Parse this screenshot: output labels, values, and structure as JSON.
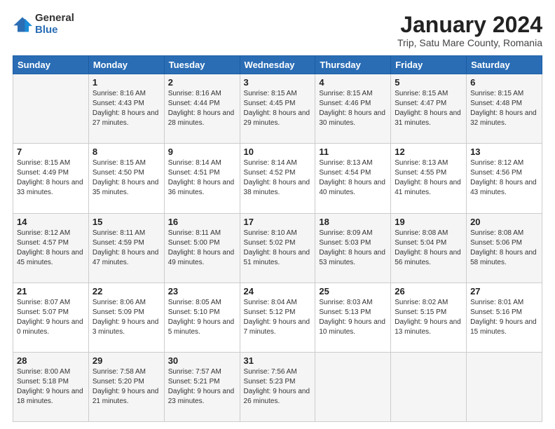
{
  "header": {
    "title": "January 2024",
    "subtitle": "Trip, Satu Mare County, Romania",
    "logo_general": "General",
    "logo_blue": "Blue"
  },
  "weekdays": [
    "Sunday",
    "Monday",
    "Tuesday",
    "Wednesday",
    "Thursday",
    "Friday",
    "Saturday"
  ],
  "weeks": [
    [
      {
        "day": "",
        "sunrise": "",
        "sunset": "",
        "daylight": "",
        "shade": true
      },
      {
        "day": "1",
        "sunrise": "8:16 AM",
        "sunset": "4:43 PM",
        "daylight": "8 hours and 27 minutes.",
        "shade": true
      },
      {
        "day": "2",
        "sunrise": "8:16 AM",
        "sunset": "4:44 PM",
        "daylight": "8 hours and 28 minutes.",
        "shade": true
      },
      {
        "day": "3",
        "sunrise": "8:15 AM",
        "sunset": "4:45 PM",
        "daylight": "8 hours and 29 minutes.",
        "shade": true
      },
      {
        "day": "4",
        "sunrise": "8:15 AM",
        "sunset": "4:46 PM",
        "daylight": "8 hours and 30 minutes.",
        "shade": true
      },
      {
        "day": "5",
        "sunrise": "8:15 AM",
        "sunset": "4:47 PM",
        "daylight": "8 hours and 31 minutes.",
        "shade": true
      },
      {
        "day": "6",
        "sunrise": "8:15 AM",
        "sunset": "4:48 PM",
        "daylight": "8 hours and 32 minutes.",
        "shade": true
      }
    ],
    [
      {
        "day": "7",
        "sunrise": "",
        "sunset": "",
        "daylight": "",
        "shade": false
      },
      {
        "day": "8",
        "sunrise": "8:15 AM",
        "sunset": "4:50 PM",
        "daylight": "8 hours and 35 minutes.",
        "shade": false
      },
      {
        "day": "9",
        "sunrise": "8:14 AM",
        "sunset": "4:51 PM",
        "daylight": "8 hours and 36 minutes.",
        "shade": false
      },
      {
        "day": "10",
        "sunrise": "8:14 AM",
        "sunset": "4:52 PM",
        "daylight": "8 hours and 38 minutes.",
        "shade": false
      },
      {
        "day": "11",
        "sunrise": "8:13 AM",
        "sunset": "4:54 PM",
        "daylight": "8 hours and 40 minutes.",
        "shade": false
      },
      {
        "day": "12",
        "sunrise": "8:13 AM",
        "sunset": "4:55 PM",
        "daylight": "8 hours and 41 minutes.",
        "shade": false
      },
      {
        "day": "13",
        "sunrise": "8:12 AM",
        "sunset": "4:56 PM",
        "daylight": "8 hours and 43 minutes.",
        "shade": false
      }
    ],
    [
      {
        "day": "14",
        "sunrise": "",
        "sunset": "",
        "daylight": "",
        "shade": true
      },
      {
        "day": "15",
        "sunrise": "8:11 AM",
        "sunset": "4:59 PM",
        "daylight": "8 hours and 47 minutes.",
        "shade": true
      },
      {
        "day": "16",
        "sunrise": "8:11 AM",
        "sunset": "5:00 PM",
        "daylight": "8 hours and 49 minutes.",
        "shade": true
      },
      {
        "day": "17",
        "sunrise": "8:10 AM",
        "sunset": "5:02 PM",
        "daylight": "8 hours and 51 minutes.",
        "shade": true
      },
      {
        "day": "18",
        "sunrise": "8:09 AM",
        "sunset": "5:03 PM",
        "daylight": "8 hours and 53 minutes.",
        "shade": true
      },
      {
        "day": "19",
        "sunrise": "8:08 AM",
        "sunset": "5:04 PM",
        "daylight": "8 hours and 56 minutes.",
        "shade": true
      },
      {
        "day": "20",
        "sunrise": "8:08 AM",
        "sunset": "5:06 PM",
        "daylight": "8 hours and 58 minutes.",
        "shade": true
      }
    ],
    [
      {
        "day": "21",
        "sunrise": "",
        "sunset": "",
        "daylight": "",
        "shade": false
      },
      {
        "day": "22",
        "sunrise": "8:06 AM",
        "sunset": "5:09 PM",
        "daylight": "9 hours and 3 minutes.",
        "shade": false
      },
      {
        "day": "23",
        "sunrise": "8:05 AM",
        "sunset": "5:10 PM",
        "daylight": "9 hours and 5 minutes.",
        "shade": false
      },
      {
        "day": "24",
        "sunrise": "8:04 AM",
        "sunset": "5:12 PM",
        "daylight": "9 hours and 7 minutes.",
        "shade": false
      },
      {
        "day": "25",
        "sunrise": "8:03 AM",
        "sunset": "5:13 PM",
        "daylight": "9 hours and 10 minutes.",
        "shade": false
      },
      {
        "day": "26",
        "sunrise": "8:02 AM",
        "sunset": "5:15 PM",
        "daylight": "9 hours and 13 minutes.",
        "shade": false
      },
      {
        "day": "27",
        "sunrise": "8:01 AM",
        "sunset": "5:16 PM",
        "daylight": "9 hours and 15 minutes.",
        "shade": false
      }
    ],
    [
      {
        "day": "28",
        "sunrise": "",
        "sunset": "",
        "daylight": "",
        "shade": true
      },
      {
        "day": "29",
        "sunrise": "7:58 AM",
        "sunset": "5:20 PM",
        "daylight": "9 hours and 21 minutes.",
        "shade": true
      },
      {
        "day": "30",
        "sunrise": "7:57 AM",
        "sunset": "5:21 PM",
        "daylight": "9 hours and 23 minutes.",
        "shade": true
      },
      {
        "day": "31",
        "sunrise": "7:56 AM",
        "sunset": "5:23 PM",
        "daylight": "9 hours and 26 minutes.",
        "shade": true
      },
      {
        "day": "",
        "sunrise": "",
        "sunset": "",
        "daylight": "",
        "shade": true
      },
      {
        "day": "",
        "sunrise": "",
        "sunset": "",
        "daylight": "",
        "shade": true
      },
      {
        "day": "",
        "sunrise": "",
        "sunset": "",
        "daylight": "",
        "shade": true
      }
    ]
  ],
  "special_sunrises": {
    "7": "8:15 AM",
    "7_sunset": "4:49 PM",
    "7_daylight": "8 hours and 33 minutes.",
    "14": "8:12 AM",
    "14_sunset": "4:57 PM",
    "14_daylight": "8 hours and 45 minutes.",
    "21": "8:07 AM",
    "21_sunset": "5:07 PM",
    "21_daylight": "9 hours and 0 minutes.",
    "28": "8:00 AM",
    "28_sunset": "5:18 PM",
    "28_daylight": "9 hours and 18 minutes."
  }
}
